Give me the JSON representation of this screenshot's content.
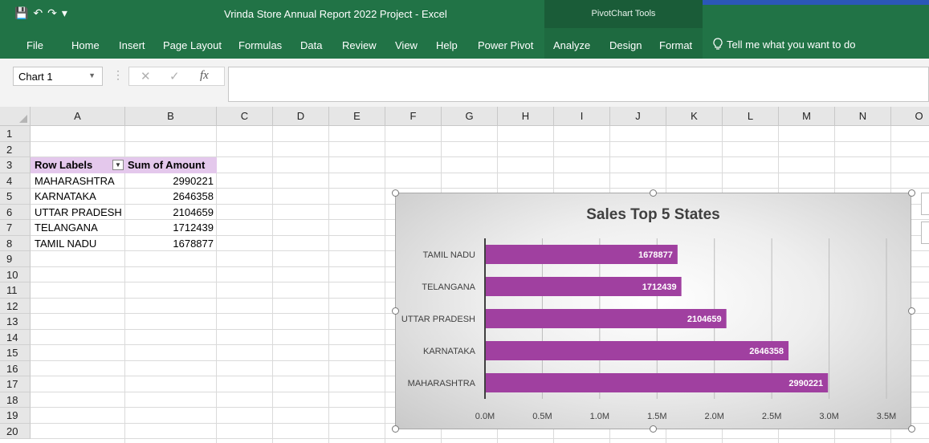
{
  "app": {
    "title": "Vrinda Store Annual Report 2022 Project  -  Excel",
    "context_tools_label": "PivotChart Tools"
  },
  "ribbon": {
    "tabs": [
      "File",
      "Home",
      "Insert",
      "Page Layout",
      "Formulas",
      "Data",
      "Review",
      "View",
      "Help",
      "Power Pivot",
      "Analyze",
      "Design",
      "Format"
    ],
    "tell_me": "Tell me what you want to do"
  },
  "formula_bar": {
    "name_box": "Chart 1",
    "fx": "fx",
    "formula": ""
  },
  "sheet": {
    "columns": [
      "A",
      "B",
      "C",
      "D",
      "E",
      "F",
      "G",
      "H",
      "I",
      "J",
      "K",
      "L",
      "M",
      "N",
      "O"
    ],
    "rows": [
      "1",
      "2",
      "3",
      "4",
      "5",
      "6",
      "7",
      "8",
      "9",
      "10",
      "11",
      "12",
      "13",
      "14",
      "15",
      "16",
      "17",
      "18",
      "19",
      "20"
    ],
    "pivot": {
      "header_label": "Row Labels",
      "header_value": "Sum of Amount",
      "rows": [
        {
          "label": "MAHARASHTRA",
          "value": "2990221"
        },
        {
          "label": "KARNATAKA",
          "value": "2646358"
        },
        {
          "label": "UTTAR PRADESH",
          "value": "2104659"
        },
        {
          "label": "TELANGANA",
          "value": "1712439"
        },
        {
          "label": "TAMIL NADU",
          "value": "1678877"
        }
      ]
    }
  },
  "chart_data": {
    "type": "bar",
    "orientation": "horizontal",
    "title": "Sales Top 5 States",
    "categories": [
      "TAMIL NADU",
      "TELANGANA",
      "UTTAR PRADESH",
      "KARNATAKA",
      "MAHARASHTRA"
    ],
    "values": [
      1678877,
      1712439,
      2104659,
      2646358,
      2990221
    ],
    "xlim": [
      0,
      3500000
    ],
    "xticks": [
      "0.0M",
      "0.5M",
      "1.0M",
      "1.5M",
      "2.0M",
      "2.5M",
      "3.0M",
      "3.5M"
    ],
    "grid": true,
    "bar_color": "#a040a0",
    "data_label_color": "#ffffff"
  },
  "colors": {
    "excel_green": "#217346",
    "pivot_header": "#e4c8ec"
  }
}
